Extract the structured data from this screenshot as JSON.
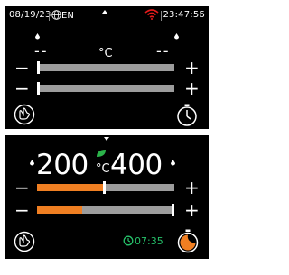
{
  "status_bar": {
    "date": "08/19/23",
    "language": "EN",
    "time": "23:47:56"
  },
  "top_panel": {
    "left_value": "--",
    "unit": "°C",
    "right_value": "--",
    "sliders": [
      {
        "name": "slider-1",
        "level": 0.0
      },
      {
        "name": "slider-2",
        "level": 0.0
      }
    ]
  },
  "bottom_panel": {
    "left_value": "200",
    "unit": "°C",
    "right_value": "400",
    "timer": "07:35",
    "sliders": [
      {
        "name": "slider-1",
        "level": 0.49
      },
      {
        "name": "slider-2",
        "level": 0.33
      }
    ]
  },
  "colors": {
    "accent_orange": "#f07f22",
    "track_gray": "#9c9c9c",
    "timer_green": "#26c16a",
    "leaf_green": "#2bb34a",
    "background": "#000000"
  },
  "icons": [
    "globe-icon",
    "wifi-icon",
    "hand-icon",
    "stopwatch-icon",
    "leaf-icon",
    "moon-icon",
    "droplet-icon",
    "clock-icon"
  ]
}
